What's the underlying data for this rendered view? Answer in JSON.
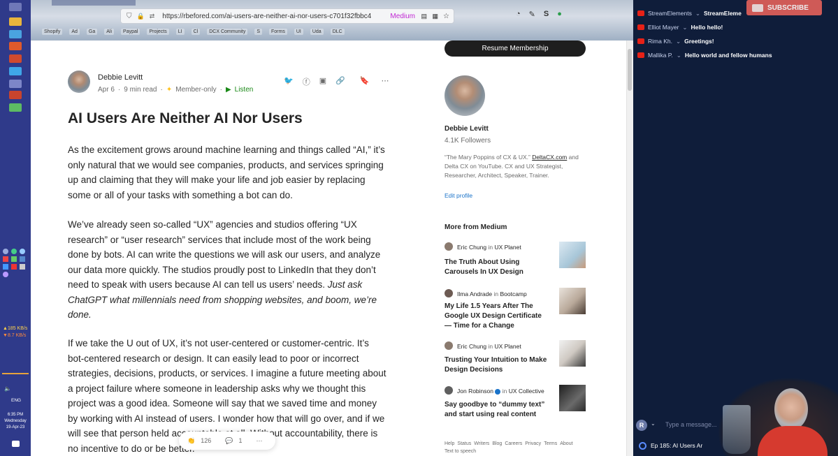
{
  "browser": {
    "url": "https://rbefored.com/ai-users-are-neither-ai-nor-users-c701f32fbbc4",
    "medium_tag": "Medium",
    "bookmarks": [
      "Shopify",
      "Ad",
      "Ga",
      "Ali",
      "Paypal",
      "Projects",
      "LI",
      "Cl",
      "DCX Community",
      "S",
      "Forms",
      "UI",
      "Uda",
      "DLC"
    ]
  },
  "taskbar": {
    "net_up": "185 KB/s",
    "net_down": "8.7 KB/s",
    "lang": "ENG",
    "time": "6:35 PM",
    "day": "Wednesday",
    "date": "19-Apr-23"
  },
  "article": {
    "author": "Debbie Levitt",
    "date": "Apr 6",
    "read_time": "9 min read",
    "member_only": "Member-only",
    "listen": "Listen",
    "title": "AI Users Are Neither AI Nor Users",
    "paragraphs": [
      "As the excitement grows around machine learning and things called “AI,” it’s only natural that we would see companies, products, and services springing up and claiming that they will make your life and job easier by replacing some or all of your tasks with something a bot can do.",
      "We’ve already seen so-called “UX” agencies and studios offering “UX research” or “user research” services that include most of the work being done by bots. AI can write the questions we will ask our users, and analyze our data more quickly. The studios proudly post to LinkedIn that they don’t need to speak with users because AI can tell us users’ needs.",
      "Just ask ChatGPT what millennials need from shopping websites, and boom, we’re done.",
      "If we take the U out of UX, it’s not user-centered or customer-centric. It’s bot-centered research or design. It can easily lead to poor or incorrect strategies, decisions, products, or services. I imagine a future meeting about a project failure where someone in leadership asks why we thought this project was a good idea. Someone will say that we saved time and money by working with AI instead of users. I wonder how that will go over, and if we will see that person held accountable at all. Without accountability, there is no incentive to do or be better."
    ],
    "claps": "126",
    "responses": "1"
  },
  "sidebar": {
    "resume_button": "Resume Membership",
    "author_name": "Debbie Levitt",
    "followers": "4.1K Followers",
    "bio_prefix": "“The Mary Poppins of CX & UX.” ",
    "bio_link": "DeltaCX.com",
    "bio_rest": " and Delta CX on YouTube. CX and UX Strategist, Researcher, Architect, Speaker, Trainer.",
    "edit_profile": "Edit profile",
    "more_from": "More from Medium",
    "in_word": "in",
    "stories": [
      {
        "author": "Eric Chung",
        "pub": "UX Planet",
        "title": "The Truth About Using Carousels In UX Design"
      },
      {
        "author": "Ilma Andrade",
        "pub": "Bootcamp",
        "title": "My Life 1.5 Years After The Google UX Design Certificate — Time for a Change"
      },
      {
        "author": "Eric Chung",
        "pub": "UX Planet",
        "title": "Trusting Your Intuition to Make Design Decisions"
      },
      {
        "author": "Jon Robinson",
        "pub": "UX Collective",
        "title": "Say goodbye to “dummy text” and start using real content"
      }
    ],
    "footer_links": [
      "Help",
      "Status",
      "Writers",
      "Blog",
      "Careers",
      "Privacy",
      "Terms",
      "About"
    ],
    "footer_tts": "Text to speech"
  },
  "stream": {
    "subscribe": "SUBSCRIBE",
    "chat": [
      {
        "user": "StreamElements",
        "msg": "StreamEleme"
      },
      {
        "user": "Elliot Mayer",
        "msg": "Hello hello!"
      },
      {
        "user": "Rima Kh.",
        "msg": "Greetings!"
      },
      {
        "user": "Mallika P.",
        "msg": "Hello world and fellow humans"
      }
    ],
    "input_avatar": "R",
    "input_placeholder": "Type a message...",
    "now_playing": "Ep 185: AI Users Ar"
  }
}
